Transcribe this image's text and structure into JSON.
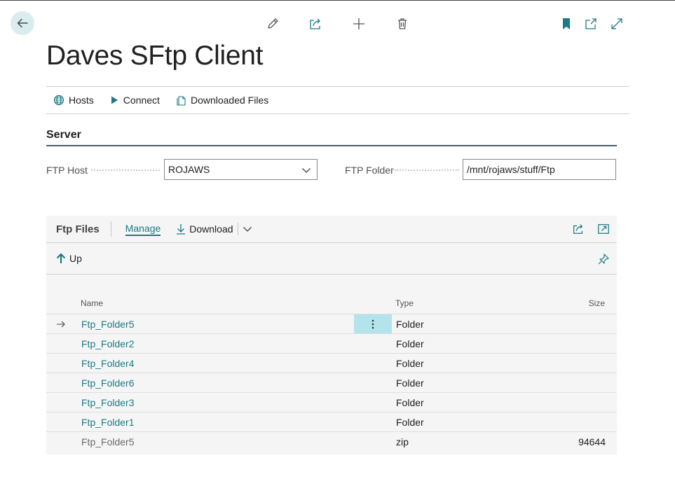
{
  "page": {
    "title": "Daves SFtp Client"
  },
  "actions": {
    "hosts": "Hosts",
    "connect": "Connect",
    "downloaded_files": "Downloaded Files"
  },
  "server": {
    "section_title": "Server",
    "ftp_host_label": "FTP Host",
    "ftp_host_value": "ROJAWS",
    "ftp_folder_label": "FTP Folder",
    "ftp_folder_value": "/mnt/rojaws/stuff/Ftp"
  },
  "ftp_files": {
    "title": "Ftp Files",
    "manage_label": "Manage",
    "download_label": "Download",
    "up_label": "Up",
    "columns": {
      "name": "Name",
      "type": "Type",
      "size": "Size"
    },
    "rows": [
      {
        "name": "Ftp_Folder5",
        "type": "Folder",
        "size": ""
      },
      {
        "name": "Ftp_Folder2",
        "type": "Folder",
        "size": ""
      },
      {
        "name": "Ftp_Folder4",
        "type": "Folder",
        "size": ""
      },
      {
        "name": "Ftp_Folder6",
        "type": "Folder",
        "size": ""
      },
      {
        "name": "Ftp_Folder3",
        "type": "Folder",
        "size": ""
      },
      {
        "name": "Ftp_Folder1",
        "type": "Folder",
        "size": ""
      },
      {
        "name": "Ftp_Folder5",
        "type": "zip",
        "size": "94644"
      }
    ]
  },
  "colors": {
    "accent": "#1b7a85",
    "selected_cell": "#b3e3eb",
    "back_button_bg": "#dbecee"
  },
  "icons": [
    "back-arrow-icon",
    "edit-pencil-icon",
    "share-icon",
    "plus-icon",
    "trash-icon",
    "bookmark-icon",
    "open-new-window-icon",
    "expand-icon",
    "globe-icon",
    "play-icon",
    "document-copy-icon",
    "download-icon",
    "chevron-down-icon",
    "up-arrow-icon",
    "pin-icon",
    "row-arrow-icon",
    "more-vertical-icon"
  ]
}
